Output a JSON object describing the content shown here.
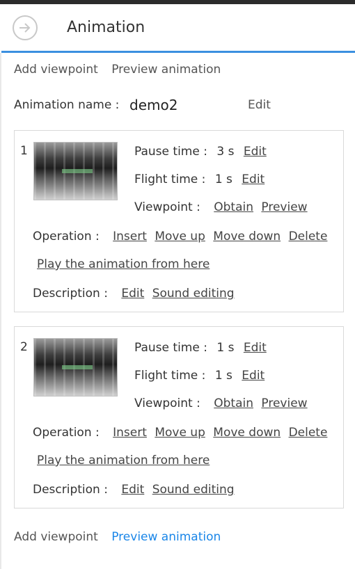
{
  "header": {
    "title": "Animation"
  },
  "top_actions": {
    "add_viewpoint": "Add viewpoint",
    "preview_animation": "Preview animation"
  },
  "animation": {
    "name_label": "Animation name :",
    "name_value": "demo2",
    "edit_label": "Edit"
  },
  "viewpoints": [
    {
      "index": "1",
      "pause_label": "Pause time :",
      "pause_value": "3 s",
      "pause_edit": "Edit",
      "flight_label": "Flight time :",
      "flight_value": "1 s",
      "flight_edit": "Edit",
      "viewpoint_label": "Viewpoint :",
      "obtain": "Obtain",
      "preview": "Preview",
      "operation_label": "Operation :",
      "insert": "Insert",
      "move_up": "Move up",
      "move_down": "Move down",
      "delete": "Delete",
      "play_from_here": "Play the animation from here",
      "description_label": "Description :",
      "description_edit": "Edit",
      "sound_editing": "Sound editing"
    },
    {
      "index": "2",
      "pause_label": "Pause time :",
      "pause_value": "1 s",
      "pause_edit": "Edit",
      "flight_label": "Flight time :",
      "flight_value": "1 s",
      "flight_edit": "Edit",
      "viewpoint_label": "Viewpoint :",
      "obtain": "Obtain",
      "preview": "Preview",
      "operation_label": "Operation :",
      "insert": "Insert",
      "move_up": "Move up",
      "move_down": "Move down",
      "delete": "Delete",
      "play_from_here": "Play the animation from here",
      "description_label": "Description :",
      "description_edit": "Edit",
      "sound_editing": "Sound editing"
    }
  ],
  "bottom_actions": {
    "add_viewpoint": "Add viewpoint",
    "preview_animation": "Preview animation"
  },
  "colors": {
    "accent": "#1a86e8",
    "header_line": "#3b8fe0"
  }
}
